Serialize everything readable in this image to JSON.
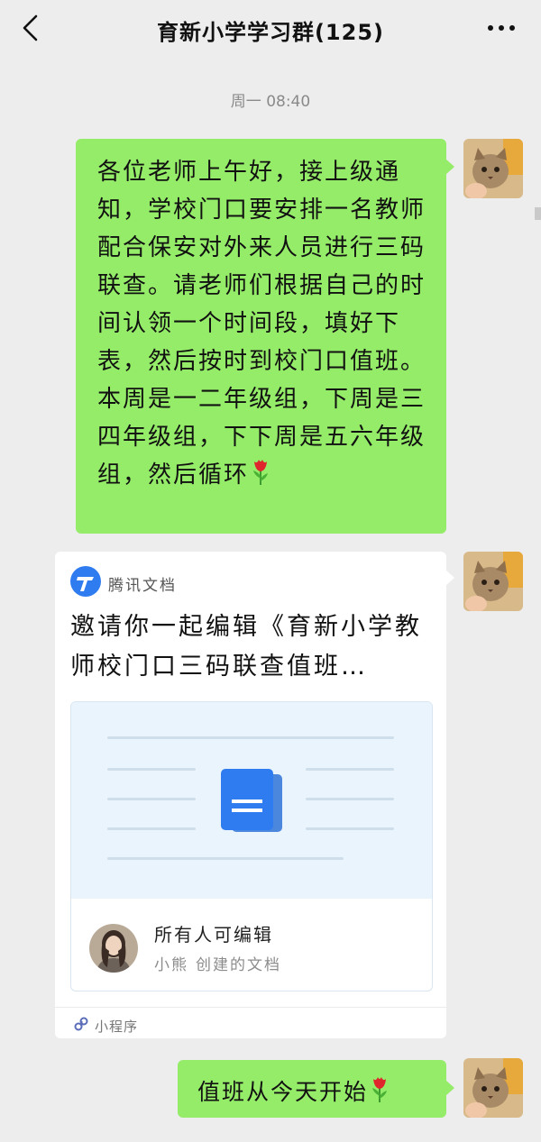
{
  "header": {
    "title": "育新小学学习群(125)"
  },
  "timestamp": "周一 08:40",
  "messages": [
    {
      "text": "各位老师上午好，接上级通知，学校门口要安排一名教师配合保安对外来人员进行三码联查。请老师们根据自己的时间认领一个时间段，填好下表，然后按时到校门口值班。本周是一二年级组，下周是三四年级组，下下周是五六年级组，然后循环"
    },
    {
      "card": {
        "source": "腾讯文档",
        "title": "邀请你一起编辑《育新小学教师校门口三码联查值班…",
        "permission": "所有人可编辑",
        "creator_name": "小熊",
        "creator_suffix": "创建的文档",
        "footer": "小程序"
      }
    },
    {
      "text": "值班从今天开始"
    }
  ],
  "colors": {
    "self_bubble": "#95ec69",
    "background": "#ededed",
    "doc_icon": "#2f7cf0"
  },
  "icons": [
    "back-arrow-icon",
    "more-icon",
    "rose-emoji",
    "tencent-docs-icon",
    "document-icon",
    "mini-program-icon"
  ]
}
